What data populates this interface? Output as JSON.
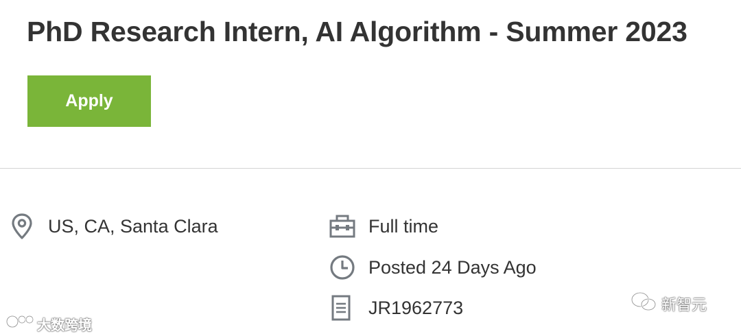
{
  "job": {
    "title": "PhD Research Intern, AI Algorithm - Summer 2023",
    "apply_label": "Apply"
  },
  "details": {
    "location": "US, CA, Santa Clara",
    "time_type": "Full time",
    "posted": "Posted 24 Days Ago",
    "requisition_id": "JR1962773"
  },
  "icons": {
    "location": "map-pin-icon",
    "time_type": "briefcase-icon",
    "posted": "clock-icon",
    "requisition_id": "document-icon"
  },
  "watermarks": {
    "left": "大数跨境",
    "right": "新智元"
  },
  "colors": {
    "apply_button": "#7ab539",
    "title_text": "#333333",
    "icon_gray": "#747a80",
    "divider": "#d4d4d4"
  }
}
